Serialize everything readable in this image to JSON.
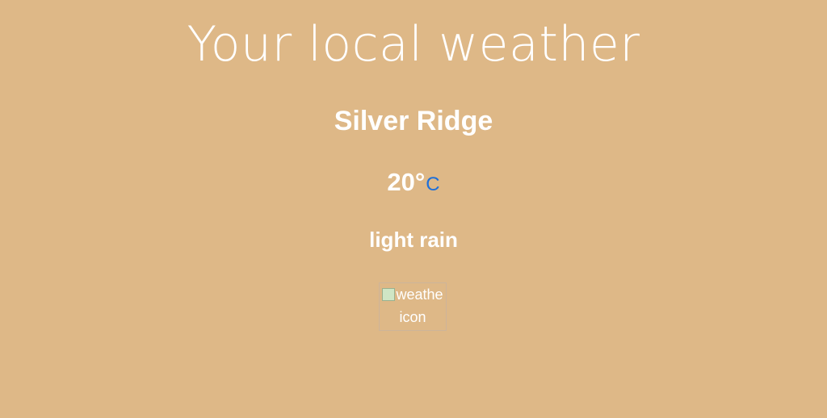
{
  "header": {
    "title": "Your local weather"
  },
  "weather": {
    "city": "Silver Ridge",
    "temperature": "20°",
    "unit": "C",
    "description": "light rain",
    "icon_alt_line1": "weathe",
    "icon_alt_line2": "icon"
  },
  "colors": {
    "background": "#deb887",
    "text": "#ffffff",
    "unit_link": "#1e6fd9"
  },
  "icons": {
    "weather_icon": "broken-image-icon"
  }
}
